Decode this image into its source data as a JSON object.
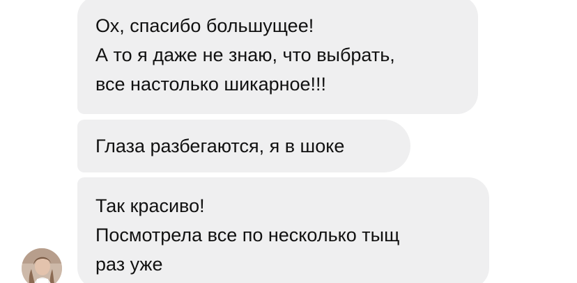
{
  "conversation": {
    "messages": [
      {
        "lines": [
          "Ох, спасибо большущее!",
          "А то я даже не знаю, что выбрать,",
          "все настолько шикарное!!!"
        ]
      },
      {
        "lines": [
          "Глаза разбегаются, я в шоке"
        ]
      },
      {
        "lines": [
          "Так красиво!",
          "Посмотрела все по несколько тыщ",
          "раз уже"
        ]
      }
    ],
    "sender": {
      "avatar_icon": "user-avatar-photo"
    }
  },
  "colors": {
    "bubble_background": "#efeff0",
    "text": "#111111",
    "page_background": "#ffffff"
  }
}
